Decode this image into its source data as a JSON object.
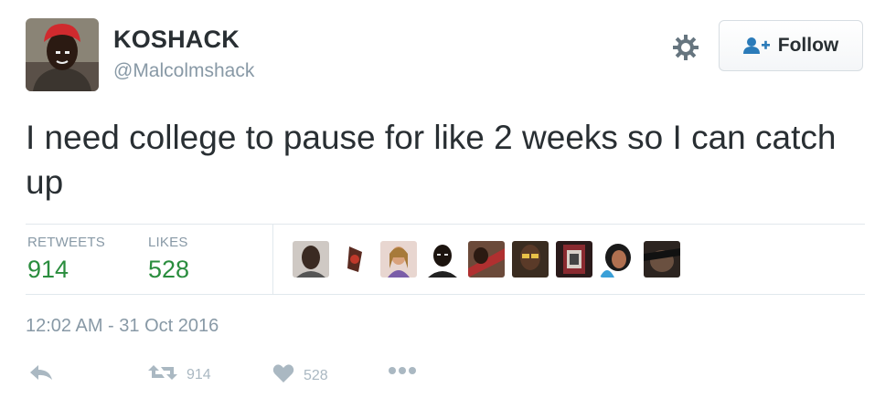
{
  "user": {
    "display_name": "KOSHACK",
    "handle": "@Malcolmshack"
  },
  "header": {
    "follow_label": "Follow",
    "settings_icon": "gear-icon",
    "follow_icon": "follow-user-icon"
  },
  "tweet": {
    "text": "I need college to pause for like 2 weeks so I can catch up",
    "timestamp": "12:02 AM - 31 Oct 2016"
  },
  "stats": {
    "retweets_label": "RETWEETS",
    "retweets_value": "914",
    "likes_label": "LIKES",
    "likes_value": "528"
  },
  "actions": {
    "reply_icon": "reply-icon",
    "retweet_icon": "retweet-icon",
    "retweet_count": "914",
    "like_icon": "heart-icon",
    "like_count": "528",
    "more_icon": "more-dots-icon"
  },
  "colors": {
    "stat_value": "#2a8d3e",
    "muted": "#8899a6",
    "action_icon": "#aab8c2",
    "follow_icon": "#2b7bb9"
  }
}
